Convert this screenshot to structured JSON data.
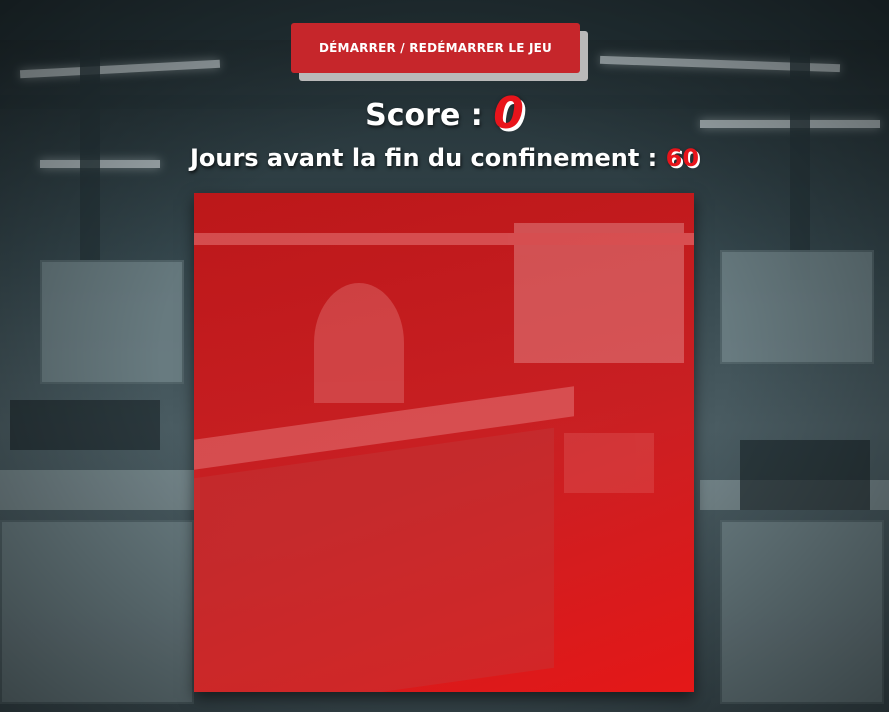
{
  "start_button": {
    "label": "DÉMARRER / REDÉMARRER LE JEU"
  },
  "score": {
    "label": "Score : ",
    "value": "0"
  },
  "days": {
    "label": "Jours avant la fin du confinement : ",
    "value": "60"
  },
  "colors": {
    "accent_red": "#c6262b",
    "value_red": "#e8141b",
    "board_red": "#d7191c"
  }
}
